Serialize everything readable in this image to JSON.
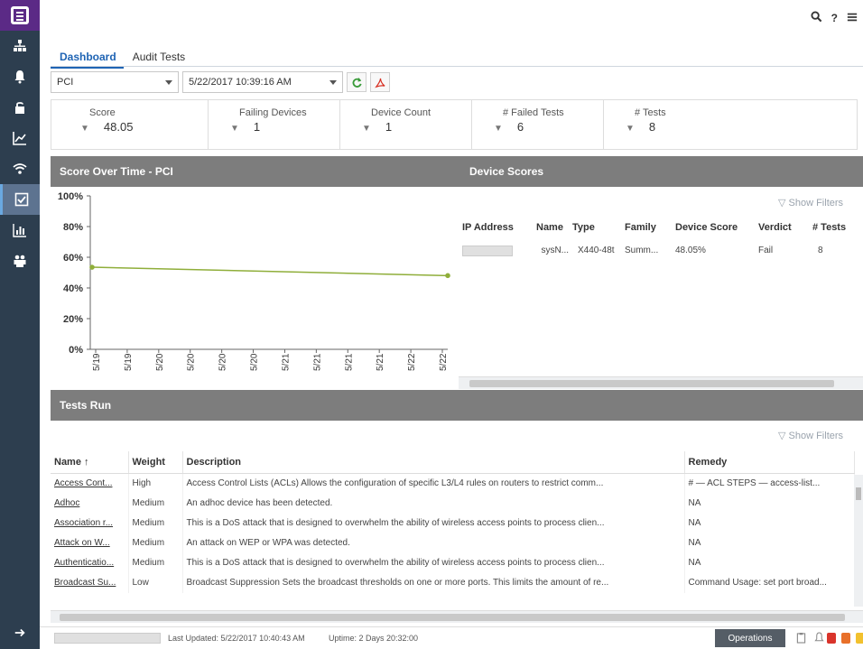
{
  "nav": {
    "items": [
      "network-icon",
      "alarm-bell-icon",
      "lock-icon",
      "analytics-icon",
      "wireless-icon",
      "compliance-icon",
      "reports-icon",
      "users-icon"
    ],
    "active_index": 5
  },
  "topbar": {
    "search": "search-icon",
    "help": "?",
    "menu": "menu-icon"
  },
  "tabs": [
    {
      "label": "Dashboard",
      "active": true
    },
    {
      "label": "Audit Tests",
      "active": false
    }
  ],
  "toolbar": {
    "group_select": "PCI",
    "time_select": "5/22/2017 10:39:16 AM"
  },
  "stats": [
    {
      "label": "Score",
      "value": "48.05"
    },
    {
      "label": "Failing Devices",
      "value": "1"
    },
    {
      "label": "Device Count",
      "value": "1"
    },
    {
      "label": "# Failed Tests",
      "value": "6"
    },
    {
      "label": "# Tests",
      "value": "8"
    }
  ],
  "score_panel": {
    "title": "Score Over Time - PCI"
  },
  "device_panel": {
    "title": "Device Scores",
    "show_filters": "Show Filters"
  },
  "device_grid": {
    "columns": [
      "IP Address",
      "Name",
      "Type",
      "Family",
      "Device Score",
      "Verdict",
      "# Tests"
    ],
    "rows": [
      {
        "name": "sysN...",
        "type": "X440-48t",
        "family": "Summ...",
        "score": "48.05%",
        "verdict": "Fail",
        "tests": "8"
      }
    ]
  },
  "chart_data": {
    "type": "line",
    "title": "",
    "xlabel": "",
    "ylabel": "",
    "y_ticks": [
      "0%",
      "20%",
      "40%",
      "60%",
      "80%",
      "100%"
    ],
    "ylim": [
      0,
      100
    ],
    "x_ticks": [
      "5/19",
      "5/19",
      "5/20",
      "5/20",
      "5/20",
      "5/20",
      "5/21",
      "5/21",
      "5/21",
      "5/21",
      "5/22",
      "5/22"
    ],
    "series": [
      {
        "points": [
          {
            "x": "5/19",
            "y": 53.5
          },
          {
            "x": "5/22",
            "y": 48.05
          }
        ],
        "color": "#8fae3a"
      }
    ],
    "grid": false
  },
  "tests_panel": {
    "title": "Tests Run",
    "show_filters": "Show Filters"
  },
  "tests_table": {
    "columns": [
      "Name",
      "Weight",
      "Description",
      "Remedy"
    ],
    "rows": [
      {
        "name": "Access Cont...",
        "weight": "High",
        "description": "Access Control Lists (ACLs) Allows the configuration of specific L3/L4 rules on routers to restrict comm...",
        "remedy": "# — ACL STEPS — access-list..."
      },
      {
        "name": "Adhoc",
        "weight": "Medium",
        "description": "An adhoc device has been detected.",
        "remedy": "NA"
      },
      {
        "name": "Association r...",
        "weight": "Medium",
        "description": "This is a DoS attack that is designed to overwhelm the ability of wireless access points to process clien...",
        "remedy": "NA"
      },
      {
        "name": "Attack on W...",
        "weight": "Medium",
        "description": "An attack on WEP or WPA was detected.",
        "remedy": "NA"
      },
      {
        "name": "Authenticatio...",
        "weight": "Medium",
        "description": "This is a DoS attack that is designed to overwhelm the ability of wireless access points to process clien...",
        "remedy": "NA"
      },
      {
        "name": "Broadcast Su...",
        "weight": "Low",
        "description": "Broadcast Suppression Sets the broadcast thresholds on one or more ports. This limits the amount of re...",
        "remedy": "Command Usage: set port broad..."
      }
    ]
  },
  "statusbar": {
    "last_updated": "Last Updated: 5/22/2017 10:40:43 AM",
    "uptime": "Uptime: 2 Days 20:32:00",
    "operations": "Operations",
    "alarm_colors": [
      "#d9342b",
      "#e8702a",
      "#f2c12e",
      "#5ab4e5"
    ]
  }
}
